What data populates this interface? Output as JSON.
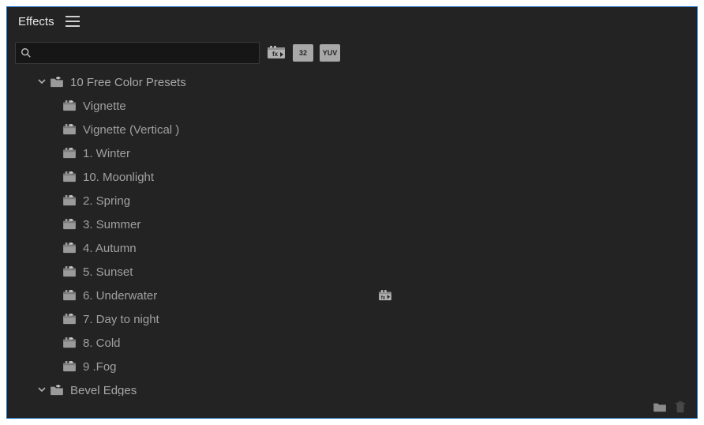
{
  "panel": {
    "title": "Effects"
  },
  "search": {
    "value": "",
    "placeholder": ""
  },
  "tree": [
    {
      "kind": "folder",
      "label": "10 Free Color Presets",
      "expanded": true,
      "children": [
        {
          "kind": "preset",
          "label": "Vignette",
          "accelerated": false
        },
        {
          "kind": "preset",
          "label": "Vignette (Vertical )",
          "accelerated": false
        },
        {
          "kind": "preset",
          "label": "1. Winter",
          "accelerated": false
        },
        {
          "kind": "preset",
          "label": "10. Moonlight",
          "accelerated": false
        },
        {
          "kind": "preset",
          "label": "2. Spring",
          "accelerated": false
        },
        {
          "kind": "preset",
          "label": "3. Summer",
          "accelerated": false
        },
        {
          "kind": "preset",
          "label": "4. Autumn",
          "accelerated": false
        },
        {
          "kind": "preset",
          "label": "5. Sunset",
          "accelerated": false
        },
        {
          "kind": "preset",
          "label": "6. Underwater",
          "accelerated": true
        },
        {
          "kind": "preset",
          "label": "7. Day to night",
          "accelerated": false
        },
        {
          "kind": "preset",
          "label": "8. Cold",
          "accelerated": false
        },
        {
          "kind": "preset",
          "label": "9 .Fog",
          "accelerated": false
        }
      ]
    },
    {
      "kind": "folder",
      "label": "Bevel Edges",
      "expanded": true,
      "children": []
    }
  ],
  "filters": {
    "accelerated": "fx",
    "bit32": "32",
    "yuv": "YUV"
  }
}
